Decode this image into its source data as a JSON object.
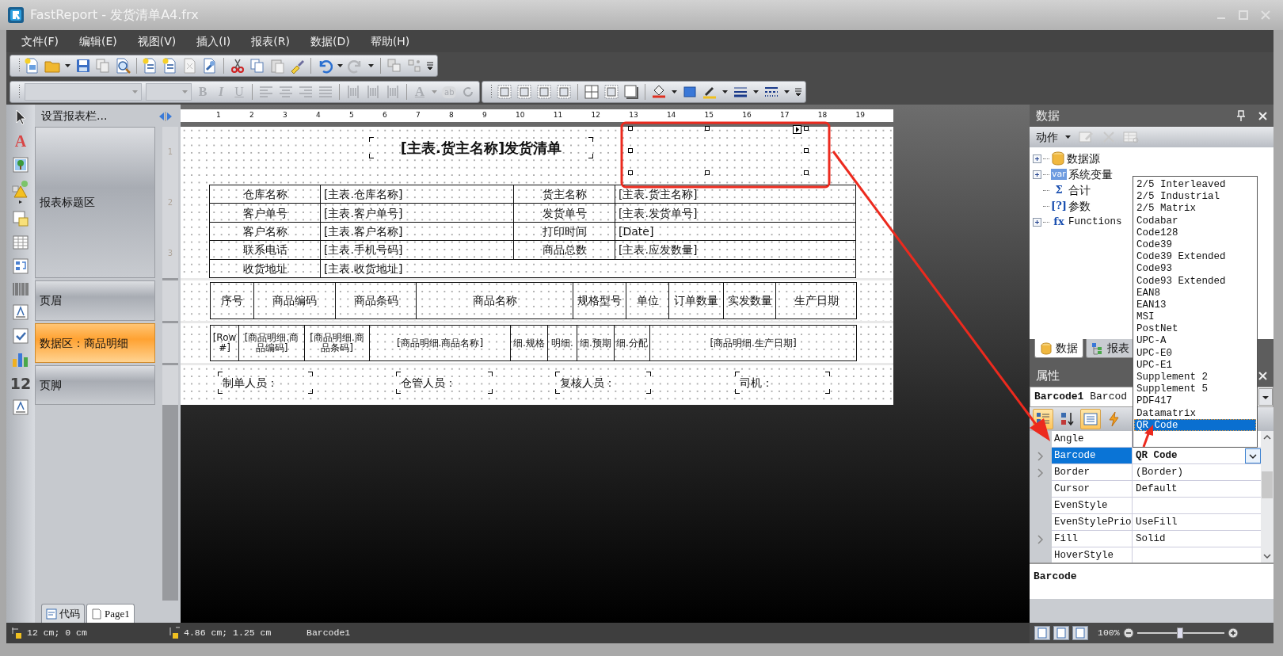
{
  "window": {
    "title": "FastReport - 发货清单A4.frx"
  },
  "menu": [
    "文件(F)",
    "编辑(E)",
    "视图(V)",
    "插入(I)",
    "报表(R)",
    "数据(D)",
    "帮助(H)"
  ],
  "format_toolbar": {
    "bold": "B",
    "italic": "I",
    "underline": "U",
    "font_color": "A",
    "highlight": "ab",
    "disabled": true
  },
  "tools": {
    "text": "A",
    "number": "12"
  },
  "bands_panel": {
    "header": "设置报表栏...",
    "bands": [
      {
        "label": "报表标题区",
        "selected": false
      },
      {
        "label": "页眉",
        "selected": false
      },
      {
        "label": "数据区：商品明细",
        "selected": true
      },
      {
        "label": "页脚",
        "selected": false
      }
    ]
  },
  "ruler": {
    "ticks": [
      "1",
      "2",
      "3",
      "4",
      "5",
      "6",
      "7",
      "8",
      "9",
      "10",
      "11",
      "12",
      "13",
      "14",
      "15",
      "16",
      "17",
      "18",
      "19"
    ],
    "vertical_ticks": [
      "1",
      "2",
      "3"
    ]
  },
  "report": {
    "title": "[主表.货主名称]发货清单",
    "info_rows": [
      [
        "仓库名称",
        "[主表.仓库名称]",
        "货主名称",
        "[主表.货主名称]"
      ],
      [
        "客户单号",
        "[主表.客户单号]",
        "发货单号",
        "[主表.发货单号]"
      ],
      [
        "客户名称",
        "[主表.客户名称]",
        "打印时间",
        "[Date]"
      ],
      [
        "联系电话",
        "[主表.手机号码]",
        "商品总数",
        "[主表.应发数量]"
      ],
      [
        "收货地址",
        "[主表.收货地址]"
      ]
    ],
    "header_cells": [
      "序号",
      "商品编码",
      "商品条码",
      "商品名称",
      "规格型号",
      "单位",
      "订单数量",
      "实发数量",
      "生产日期"
    ],
    "data_cells": [
      "[Row#]",
      "[商品明细.商品编码]",
      "[商品明细.商品条码]",
      "[商品明细.商品名称]",
      "细.规格",
      "明细.",
      "细.预期",
      "细.分配",
      "[商品明细.生产日期]"
    ],
    "footer_labels": [
      "制单人员：",
      "仓管人员：",
      "复核人员：",
      "司机："
    ]
  },
  "page_tabs": [
    {
      "label": "代码",
      "selected": false
    },
    {
      "label": "Page1",
      "selected": true
    }
  ],
  "data_panel": {
    "title": "数据",
    "action": "动作",
    "tree": [
      {
        "label": "数据源",
        "kind": "datasource",
        "expandable": true
      },
      {
        "label": "系统变量",
        "kind": "badge",
        "badge": "var",
        "expandable": true
      },
      {
        "label": "合计",
        "kind": "symbol",
        "badge": "Σ",
        "expandable": false
      },
      {
        "label": "参数",
        "kind": "symbol",
        "badge": "[?]",
        "expandable": false
      },
      {
        "label": "Functions",
        "kind": "symbol",
        "badge": "fx",
        "expandable": true
      }
    ],
    "tabs": [
      {
        "label": "数据",
        "selected": true
      },
      {
        "label": "报表",
        "selected": false
      }
    ]
  },
  "properties_panel": {
    "title": "属性",
    "object_name": "Barcode1",
    "object_type": "Barcod",
    "view_buttons": [
      {
        "kind": "categorized",
        "selected": true
      },
      {
        "kind": "alphabetical",
        "selected": false
      },
      {
        "kind": "properties",
        "selected": true
      },
      {
        "kind": "events",
        "selected": false
      }
    ],
    "rows": [
      {
        "name": "Angle",
        "expandable": false,
        "selected": false
      },
      {
        "name": "Barcode",
        "value": "QR Code",
        "expandable": true,
        "selected": true
      },
      {
        "name": "Border",
        "value": "(Border)",
        "expandable": true,
        "selected": false
      },
      {
        "name": "Cursor",
        "value": "Default",
        "expandable": false,
        "selected": false
      },
      {
        "name": "EvenStyle",
        "expandable": false,
        "selected": false
      },
      {
        "name": "EvenStylePrio",
        "value": "UseFill",
        "expandable": false,
        "selected": false
      },
      {
        "name": "Fill",
        "value": "Solid",
        "expandable": true,
        "selected": false
      },
      {
        "name": "HoverStyle",
        "expandable": false,
        "selected": false
      }
    ],
    "description": "Barcode"
  },
  "dropdown": {
    "items": [
      {
        "label": "2/5 Interleaved",
        "selected": false
      },
      {
        "label": "2/5 Industrial",
        "selected": false
      },
      {
        "label": "2/5 Matrix",
        "selected": false
      },
      {
        "label": "Codabar",
        "selected": false
      },
      {
        "label": "Code128",
        "selected": false
      },
      {
        "label": "Code39",
        "selected": false
      },
      {
        "label": "Code39 Extended",
        "selected": false
      },
      {
        "label": "Code93",
        "selected": false
      },
      {
        "label": "Code93 Extended",
        "selected": false
      },
      {
        "label": "EAN8",
        "selected": false
      },
      {
        "label": "EAN13",
        "selected": false
      },
      {
        "label": "MSI",
        "selected": false
      },
      {
        "label": "PostNet",
        "selected": false
      },
      {
        "label": "UPC-A",
        "selected": false
      },
      {
        "label": "UPC-E0",
        "selected": false
      },
      {
        "label": "UPC-E1",
        "selected": false
      },
      {
        "label": "Supplement 2",
        "selected": false
      },
      {
        "label": "Supplement 5",
        "selected": false
      },
      {
        "label": "PDF417",
        "selected": false
      },
      {
        "label": "Datamatrix",
        "selected": false
      },
      {
        "label": "QR Code",
        "selected": true
      }
    ]
  },
  "status_bar": {
    "position": "12 cm; 0 cm",
    "size": "4.86 cm; 1.25 cm",
    "object": "Barcode1",
    "zoom": "100%",
    "zoom_slider": {
      "level": 0.49
    }
  }
}
